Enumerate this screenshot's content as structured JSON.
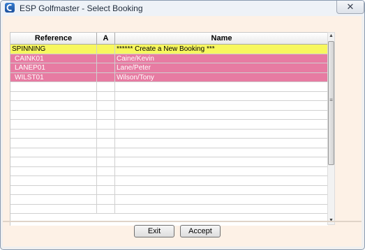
{
  "window": {
    "title": "ESP Golfmaster - Select Booking",
    "close_glyph": "✕",
    "app_icon": "golfmaster-app-icon"
  },
  "grid": {
    "columns": [
      "Reference",
      "A",
      "Name"
    ],
    "rows": [
      {
        "reference": "SPINNING",
        "a": "",
        "name": "****** Create a New Booking ***",
        "style": "yellow"
      },
      {
        "reference": "CAINK01",
        "a": "",
        "name": "Caine/Kevin",
        "style": "pink"
      },
      {
        "reference": "LANEP01",
        "a": "",
        "name": "Lane/Peter",
        "style": "pink"
      },
      {
        "reference": "WILST01",
        "a": "",
        "name": "Wilson/Tony",
        "style": "pink"
      }
    ],
    "empty_row_count": 14
  },
  "buttons": {
    "exit": "Exit",
    "accept": "Accept"
  },
  "colors": {
    "create_row": "#f7f75e",
    "selected_rows": "#e77ba2",
    "client_background": "#fdf1e6"
  }
}
